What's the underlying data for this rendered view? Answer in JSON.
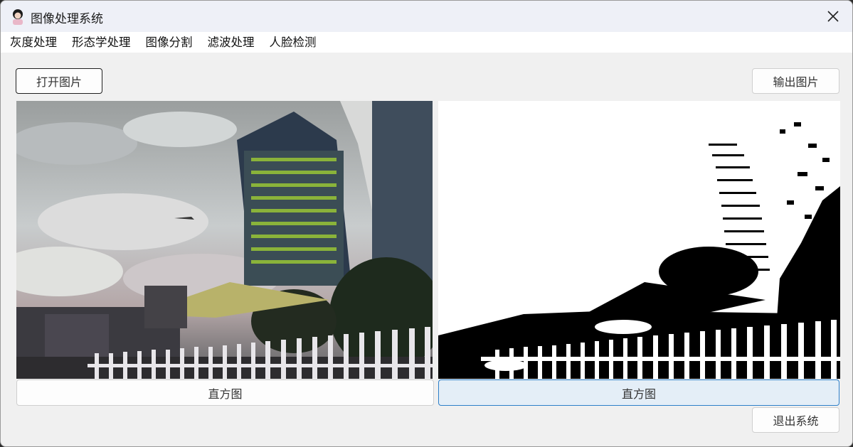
{
  "window": {
    "title": "图像处理系统"
  },
  "menu": [
    "灰度处理",
    "形态学处理",
    "图像分割",
    "滤波处理",
    "人脸检测"
  ],
  "buttons": {
    "open": "打开图片",
    "export": "输出图片",
    "histogram_left": "直方图",
    "histogram_right": "直方图",
    "exit": "退出系统"
  },
  "images": {
    "left": {
      "description_icon": "image-original-icon"
    },
    "right": {
      "description_icon": "image-binary-icon"
    }
  },
  "colors": {
    "accent": "#2d7fc9",
    "window_bg": "#f0f0f0",
    "titlebar": "#eef0f7"
  }
}
